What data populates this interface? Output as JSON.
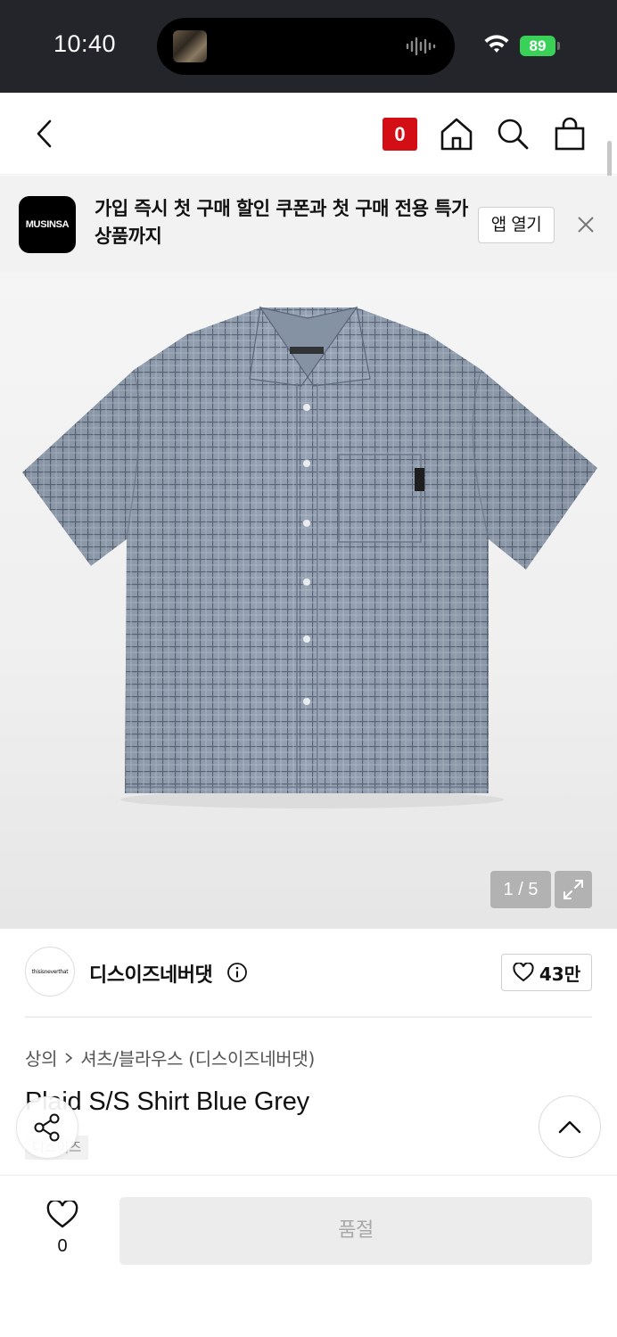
{
  "status_bar": {
    "time": "10:40",
    "battery": "89"
  },
  "nav": {
    "cart_count": "0",
    "icons": [
      "back-icon",
      "home-icon",
      "search-icon",
      "bag-icon"
    ]
  },
  "app_banner": {
    "logo_text": "MUSINSA",
    "message": "가입 즉시 첫 구매 할인 쿠폰과 첫 구매 전용 특가 상품까지",
    "open_app_label": "앱 열기"
  },
  "gallery": {
    "counter": "1 / 5"
  },
  "brand": {
    "logo_text": "thisisneverthat",
    "name": "디스이즈네버댓",
    "likes": "43만"
  },
  "product": {
    "category_parent": "상의",
    "category_child": "셔츠/블라우스 (디스이즈네버댓)",
    "title": "Plaid S/S Shirt Blue Grey",
    "tag": "디스이즈"
  },
  "bottom_bar": {
    "wish_count": "0",
    "buy_label": "품절"
  },
  "colors": {
    "status_bar_bg": "#24252a",
    "cart_badge": "#d30f15",
    "battery": "#3ad159",
    "shirt": "#8d9aab"
  }
}
